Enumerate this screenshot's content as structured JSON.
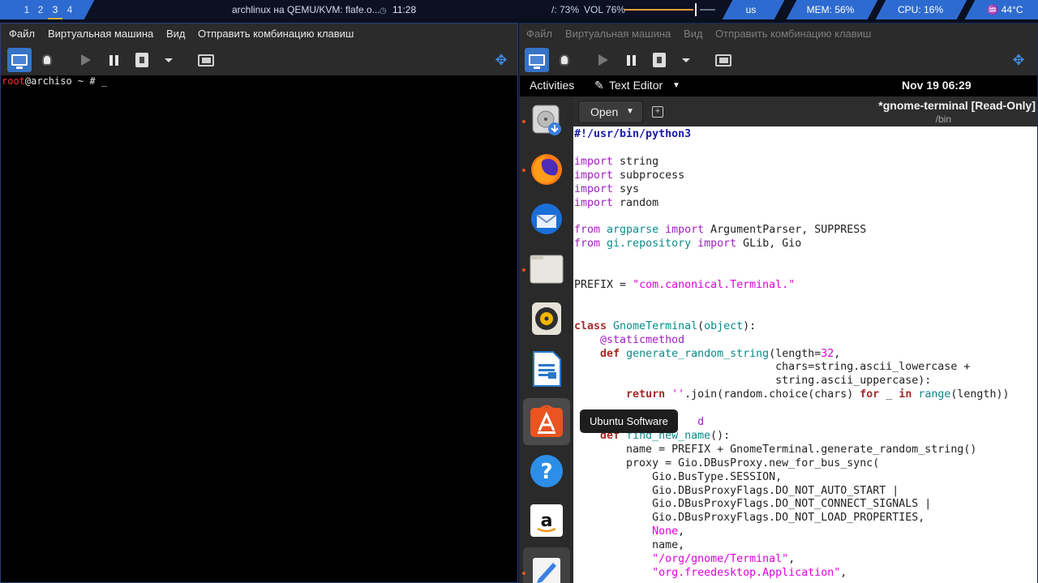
{
  "topbar": {
    "workspaces": [
      "1",
      "2",
      "3",
      "4"
    ],
    "active_workspace": "3",
    "window_title": "archlinux на QEMU/KVM: flafe.o...",
    "clock_icon": "clock-icon",
    "time": "11:28",
    "brightness": "/: 73%",
    "volume": "VOL 76%",
    "volume_level": 0.76,
    "layout": "us",
    "mem": "MEM: 56%",
    "cpu": "CPU: 16%",
    "temp": "♒ 44°C",
    "accent": "#2e6bd0"
  },
  "vm_window": {
    "menu": [
      "Файл",
      "Виртуальная машина",
      "Вид",
      "Отправить комбинацию клавиш"
    ],
    "toolbar_icons": [
      "monitor-icon",
      "bulb-icon",
      "play-icon",
      "pause-icon",
      "stop-icon",
      "dropdown-caret-icon",
      "screenshot-icon",
      "fullscreen-icon"
    ]
  },
  "terminal": {
    "user": "root",
    "host": "@archiso",
    "prompt": " ~ # _"
  },
  "gnome": {
    "activities": "Activities",
    "app_menu": "Text Editor",
    "clock": "Nov 19  06:29",
    "dock_apps": [
      "install-icon",
      "firefox-icon",
      "thunderbird-icon",
      "files-icon",
      "rhythmbox-icon",
      "writer-icon",
      "ubuntu-software-icon",
      "help-icon",
      "amazon-icon",
      "text-editor-icon"
    ],
    "tooltip": "Ubuntu Software"
  },
  "editor": {
    "open_label": "Open",
    "title": "*gnome-terminal [Read-Only]",
    "path": "/bin",
    "code": {
      "shebang": "#!/usr/bin/python3",
      "kw_import": "import",
      "kw_from": "from",
      "kw_class": "class",
      "kw_def": "def",
      "kw_return": "return",
      "kw_for": "for",
      "kw_in": "in",
      "imp1": " string",
      "imp2": " subprocess",
      "imp3": " sys",
      "imp4": " random",
      "mod1": " argparse ",
      "imp5": " ArgumentParser, SUPPRESS",
      "mod2": " gi.repository ",
      "imp6": " GLib, Gio",
      "prefix_lhs": "PREFIX = ",
      "prefix_val": "\"com.canonical.Terminal.\"",
      "class_name": " GnomeTerminal",
      "class_obj": "object",
      "decorator1": "@staticmethod",
      "func1": " generate_random_string",
      "func1_arg": "(length=",
      "num32": "32",
      "func1_tail": ",",
      "chars1": "                               chars=string.ascii_lowercase +",
      "chars2": "                               string.ascii_uppercase):",
      "ret_str": "''",
      "ret_mid": ".join(random.choice(chars) ",
      "ret_in_sp": " _ ",
      "ret_range": "range",
      "ret_tail": "(length))",
      "decorator2_tail": "d",
      "func2": " find_new_name",
      "func2_tail": "():",
      "name_line": "        name = PREFIX + GnomeTerminal.generate_random_string()",
      "proxy_line": "        proxy = Gio.DBusProxy.new_for_bus_sync(",
      "arg1": "            Gio.BusType.SESSION,",
      "arg2": "            Gio.DBusProxyFlags.DO_NOT_AUTO_START |",
      "arg3": "            Gio.DBusProxyFlags.DO_NOT_CONNECT_SIGNALS |",
      "arg4": "            Gio.DBusProxyFlags.DO_NOT_LOAD_PROPERTIES,",
      "none_val": "None",
      "name_arg": "            name,",
      "str_path": "\"/org/gnome/Terminal\"",
      "str_iface": "\"org.freedesktop.Application\""
    }
  }
}
